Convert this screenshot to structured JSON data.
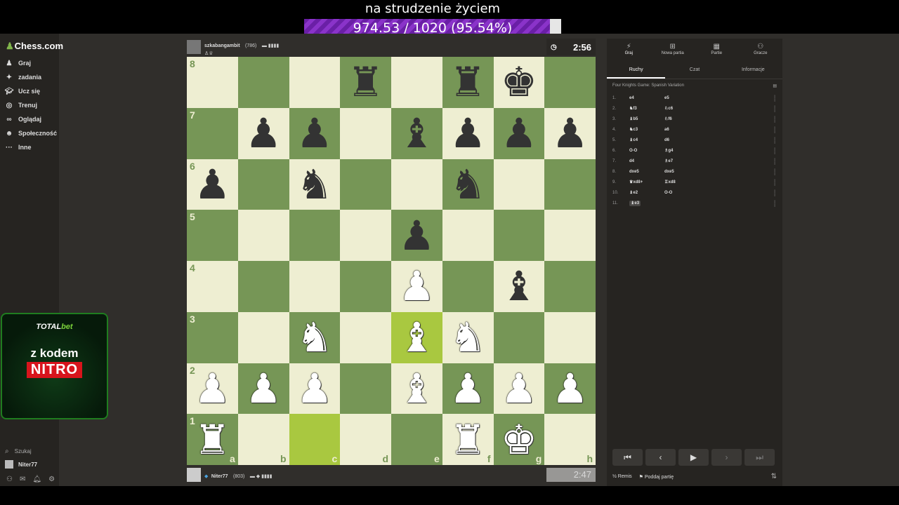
{
  "overlay": {
    "title": "na strudzenie życiem",
    "progress_text": "974.53 / 1020 (95.54%)",
    "progress_fraction": 0.9554
  },
  "sidebar": {
    "logo": "Chess.com",
    "items": [
      {
        "label": "Graj",
        "icon": "pawn-icon"
      },
      {
        "label": "zadania",
        "icon": "puzzle-icon"
      },
      {
        "label": "Ucz się",
        "icon": "graduation-cap-icon"
      },
      {
        "label": "Trenuj",
        "icon": "target-icon"
      },
      {
        "label": "Oglądaj",
        "icon": "binoculars-icon"
      },
      {
        "label": "Społeczność",
        "icon": "community-icon"
      },
      {
        "label": "Inne",
        "icon": "more-icon"
      }
    ],
    "search_label": "Szukaj",
    "username": "Niter77"
  },
  "ad": {
    "brand_part1": "TOTAL",
    "brand_part2": "bet",
    "line1": "z kodem",
    "line2": "NITRO"
  },
  "top_player": {
    "name": "szkabangambit",
    "rating": "(786)",
    "clock": "2:56"
  },
  "bottom_player": {
    "name": "Niter77",
    "rating": "(803)",
    "clock": "2:47"
  },
  "board": {
    "files": [
      "a",
      "b",
      "c",
      "d",
      "e",
      "f",
      "g",
      "h"
    ],
    "ranks": [
      "8",
      "7",
      "6",
      "5",
      "4",
      "3",
      "2",
      "1"
    ],
    "pieces": [
      {
        "sq": "d8",
        "p": "r"
      },
      {
        "sq": "f8",
        "p": "r"
      },
      {
        "sq": "g8",
        "p": "k"
      },
      {
        "sq": "b7",
        "p": "p"
      },
      {
        "sq": "c7",
        "p": "p"
      },
      {
        "sq": "e7",
        "p": "b"
      },
      {
        "sq": "f7",
        "p": "p"
      },
      {
        "sq": "g7",
        "p": "p"
      },
      {
        "sq": "h7",
        "p": "p"
      },
      {
        "sq": "a6",
        "p": "p"
      },
      {
        "sq": "c6",
        "p": "n"
      },
      {
        "sq": "f6",
        "p": "n"
      },
      {
        "sq": "e5",
        "p": "p"
      },
      {
        "sq": "e4",
        "p": "P"
      },
      {
        "sq": "g4",
        "p": "b"
      },
      {
        "sq": "c3",
        "p": "N"
      },
      {
        "sq": "e3",
        "p": "B"
      },
      {
        "sq": "f3",
        "p": "N"
      },
      {
        "sq": "a2",
        "p": "P"
      },
      {
        "sq": "b2",
        "p": "P"
      },
      {
        "sq": "c2",
        "p": "P"
      },
      {
        "sq": "e2",
        "p": "B"
      },
      {
        "sq": "f2",
        "p": "P"
      },
      {
        "sq": "g2",
        "p": "P"
      },
      {
        "sq": "h2",
        "p": "P"
      },
      {
        "sq": "a1",
        "p": "R"
      },
      {
        "sq": "f1",
        "p": "R"
      },
      {
        "sq": "g1",
        "p": "K"
      }
    ],
    "highlights": [
      "c1",
      "e3"
    ]
  },
  "panel": {
    "tabs": [
      {
        "label": "Graj",
        "icon": "lightning-icon"
      },
      {
        "label": "Nowa partia",
        "icon": "plus-icon"
      },
      {
        "label": "Partie",
        "icon": "board-icon"
      },
      {
        "label": "Gracze",
        "icon": "players-icon"
      }
    ],
    "sub_tabs": [
      "Ruchy",
      "Czat",
      "Informacje"
    ],
    "opening": "Four Knights Game: Spanish Variation",
    "moves": [
      {
        "n": "1.",
        "w": "e4",
        "b": "e5"
      },
      {
        "n": "2.",
        "w": "♞f3",
        "b": "♘c6"
      },
      {
        "n": "3.",
        "w": "♝b5",
        "b": "♘f6"
      },
      {
        "n": "4.",
        "w": "♞c3",
        "b": "a6"
      },
      {
        "n": "5.",
        "w": "♝c4",
        "b": "d6"
      },
      {
        "n": "6.",
        "w": "O-O",
        "b": "♗g4"
      },
      {
        "n": "7.",
        "w": "d4",
        "b": "♗e7"
      },
      {
        "n": "8.",
        "w": "dxe5",
        "b": "dxe5"
      },
      {
        "n": "9.",
        "w": "♛xd8+",
        "b": "♖xd8"
      },
      {
        "n": "10.",
        "w": "♝e2",
        "b": "O-O"
      },
      {
        "n": "11.",
        "w": "♝e3",
        "b": ""
      }
    ],
    "actions": {
      "draw": "Remis",
      "resign": "Poddaj partię"
    }
  }
}
